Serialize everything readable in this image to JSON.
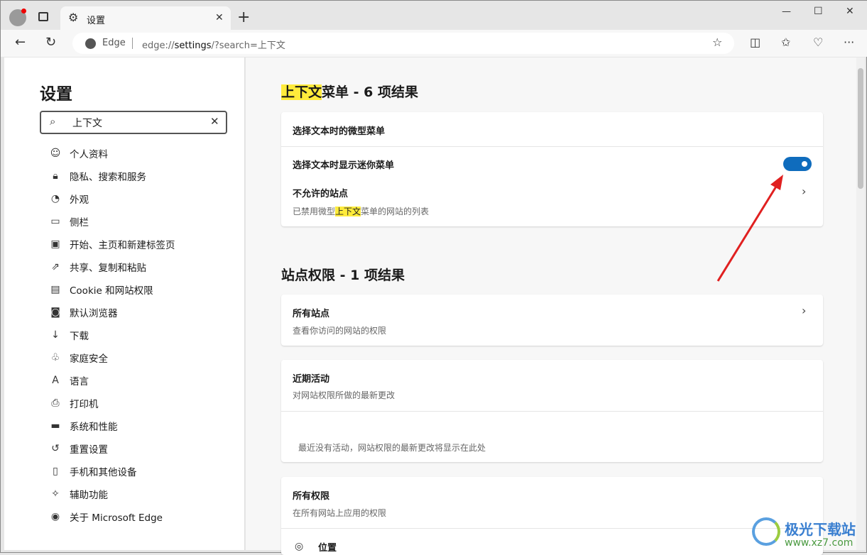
{
  "window": {
    "tab_title": "设置",
    "new_tab": "+",
    "controls": [
      "—",
      "☐",
      "✕"
    ]
  },
  "address": {
    "site_label": "Edge",
    "url_prefix": "edge://",
    "url_host": "settings",
    "url_rest": "/?search=上下文"
  },
  "sidebar": {
    "title": "设置",
    "search_value": "上下文",
    "items": [
      {
        "icon": "person-icon",
        "glyph": "☺",
        "label": "个人资料"
      },
      {
        "icon": "lock-icon",
        "glyph": "🔒︎",
        "label": "隐私、搜索和服务"
      },
      {
        "icon": "palette-icon",
        "glyph": "◔",
        "label": "外观"
      },
      {
        "icon": "sidebar-icon",
        "glyph": "▭",
        "label": "侧栏"
      },
      {
        "icon": "home-icon",
        "glyph": "▣",
        "label": "开始、主页和新建标签页"
      },
      {
        "icon": "share-icon",
        "glyph": "⇗",
        "label": "共享、复制和粘贴"
      },
      {
        "icon": "cookie-icon",
        "glyph": "▤",
        "label": "Cookie 和网站权限"
      },
      {
        "icon": "browser-icon",
        "glyph": "◙",
        "label": "默认浏览器"
      },
      {
        "icon": "download-icon",
        "glyph": "↓",
        "label": "下载"
      },
      {
        "icon": "family-icon",
        "glyph": "♧",
        "label": "家庭安全"
      },
      {
        "icon": "language-icon",
        "glyph": "A",
        "label": "语言"
      },
      {
        "icon": "printer-icon",
        "glyph": "⎙",
        "label": "打印机"
      },
      {
        "icon": "laptop-icon",
        "glyph": "▬",
        "label": "系统和性能"
      },
      {
        "icon": "reset-icon",
        "glyph": "↺",
        "label": "重置设置"
      },
      {
        "icon": "phone-icon",
        "glyph": "▯",
        "label": "手机和其他设备"
      },
      {
        "icon": "accessibility-icon",
        "glyph": "✧",
        "label": "辅助功能"
      },
      {
        "icon": "edge-icon",
        "glyph": "◉",
        "label": "关于 Microsoft Edge"
      }
    ]
  },
  "main": {
    "section1": {
      "title_hl": "上下文",
      "title_rest": "菜单 - 6 项结果",
      "header": "选择文本时的微型菜单",
      "toggle_label": "选择文本时显示迷你菜单",
      "toggle_on": true,
      "blocked_title": "不允许的站点",
      "blocked_sub_a": "已禁用微型",
      "blocked_sub_hl": "上下文",
      "blocked_sub_b": "菜单的网站的列表"
    },
    "section2": {
      "title": "站点权限 - 1 项结果",
      "all_sites": "所有站点",
      "all_sites_sub": "查看你访问的网站的权限",
      "recent": "近期活动",
      "recent_sub": "对网站权限所做的最新更改",
      "recent_empty": "最近没有活动，网站权限的最新更改将显示在此处",
      "all_perms": "所有权限",
      "all_perms_sub": "在所有网站上应用的权限",
      "location": "位置"
    }
  },
  "watermark": {
    "name": "极光下载站",
    "url": "www.xz7.com"
  },
  "colors": {
    "accent": "#0f6cbd",
    "highlight": "#ffeb3b",
    "arrow": "#e02020"
  }
}
